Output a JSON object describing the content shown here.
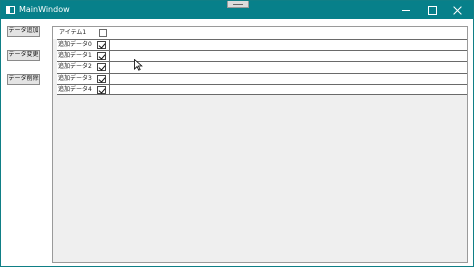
{
  "window": {
    "title": "MainWindow"
  },
  "toolbar": {
    "add_label": "データ追加",
    "edit_label": "データ変更",
    "delete_label": "データ削除"
  },
  "grid": {
    "header": {
      "label": "アイテム1",
      "checked": false
    },
    "rows": [
      {
        "label": "追加データ0",
        "checked": true
      },
      {
        "label": "追加データ1",
        "checked": true
      },
      {
        "label": "追加データ2",
        "checked": true
      },
      {
        "label": "追加データ3",
        "checked": true
      },
      {
        "label": "追加データ4",
        "checked": true
      }
    ]
  },
  "colors": {
    "titlebar": "#07808a",
    "grid_background": "#efefef"
  }
}
